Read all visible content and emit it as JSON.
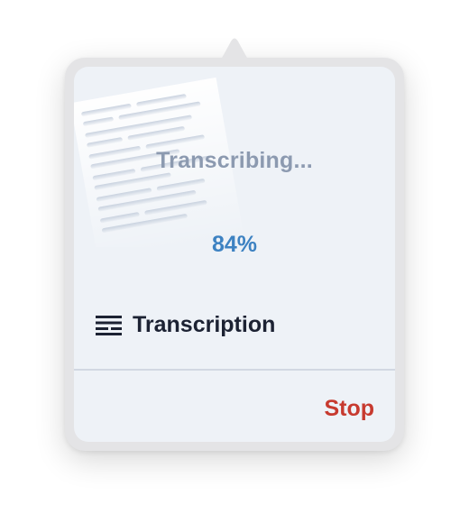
{
  "status": {
    "title": "Transcribing...",
    "progress_label": "84%",
    "progress_fraction": 0.84
  },
  "transcription": {
    "label": "Transcription",
    "icon": "transcript-lines-icon"
  },
  "actions": {
    "stop_label": "Stop"
  },
  "colors": {
    "accent_blue": "#3d82c2",
    "stop_red": "#c73a2f",
    "status_gray": "#8c9ab0",
    "label_dark": "#1c2233",
    "card_bg": "#eef2f7"
  }
}
